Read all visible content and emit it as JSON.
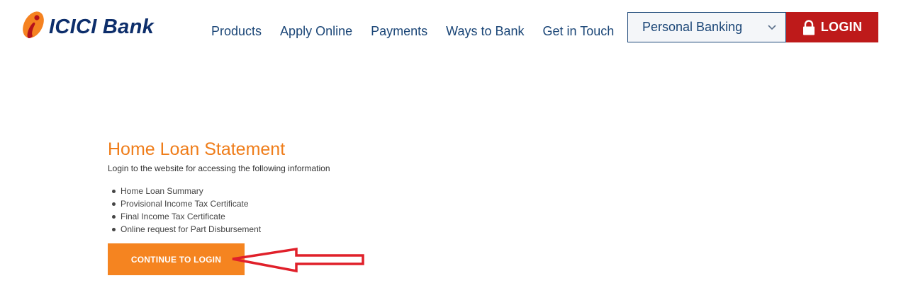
{
  "brand": {
    "name": "ICICI Bank",
    "logo_icon": "icici-logo-icon",
    "colors": {
      "logo_orange": "#f58220",
      "logo_red": "#b5121b",
      "navy": "#0d2e6b"
    }
  },
  "nav": {
    "items": [
      {
        "label": "Products"
      },
      {
        "label": "Apply Online"
      },
      {
        "label": "Payments"
      },
      {
        "label": "Ways to Bank"
      },
      {
        "label": "Get in Touch"
      }
    ]
  },
  "segment_select": {
    "selected": "Personal Banking",
    "icon": "chevron-down-icon"
  },
  "login_button": {
    "label": "LOGIN",
    "icon": "lock-icon",
    "color": "#be1a1a"
  },
  "main": {
    "title": "Home Loan Statement",
    "subtitle": "Login to the website for accessing the following information",
    "items": [
      {
        "label": "Home Loan Summary"
      },
      {
        "label": "Provisional Income Tax Certificate"
      },
      {
        "label": "Final Income Tax Certificate"
      },
      {
        "label": "Online request for Part Disbursement"
      }
    ],
    "cta_label": "CONTINUE TO LOGIN",
    "accent_color": "#f58420"
  },
  "annotation": {
    "arrow_color": "#e0202a",
    "icon": "red-arrow-icon"
  }
}
